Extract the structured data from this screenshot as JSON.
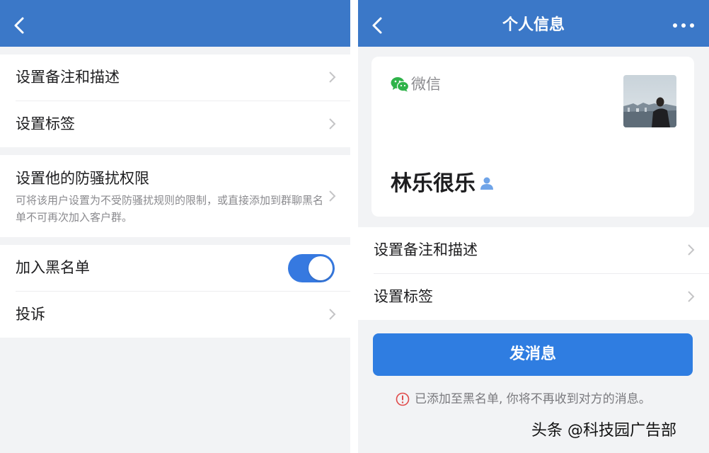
{
  "left_panel": {
    "rows": {
      "remark": "设置备注和描述",
      "tags": "设置标签",
      "anti_harass": {
        "title": "设置他的防骚扰权限",
        "description": "可将该用户设置为不受防骚扰规则的限制，或直接添加到群聊黑名单不可再次加入客户群。"
      },
      "blacklist": {
        "label": "加入黑名单",
        "enabled": true
      },
      "complaint": "投诉"
    }
  },
  "right_panel": {
    "title": "个人信息",
    "card": {
      "source_label": "微信",
      "name": "林乐很乐"
    },
    "rows": {
      "remark": "设置备注和描述",
      "tags": "设置标签"
    },
    "send_button": "发消息",
    "notice": "已添加至黑名单, 你将不再收到对方的消息。"
  },
  "watermark": "头条 @科技园广告部",
  "colors": {
    "navbar": "#3b78c8",
    "toggle_on": "#3679e0",
    "primary_button": "#2f7de1",
    "wechat_green": "#2fb34a",
    "warning_red": "#e04a4a",
    "page_bg": "#f2f3f5"
  },
  "icons": {
    "back": "chevron-left-icon",
    "more": "more-dots-icon",
    "row_arrow": "chevron-right-icon",
    "wechat": "wechat-icon",
    "contact": "person-icon",
    "notice": "info-circle-icon"
  }
}
